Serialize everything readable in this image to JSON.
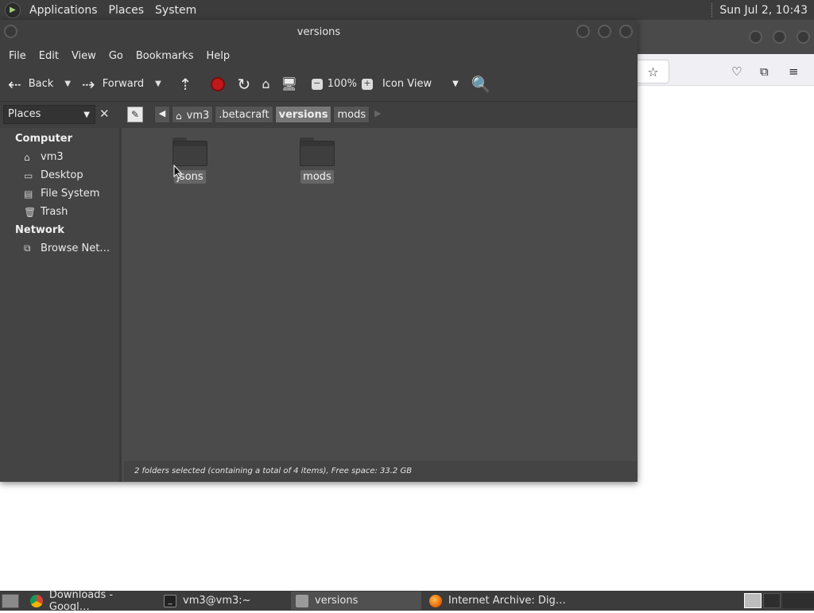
{
  "top_panel": {
    "menus": [
      "Applications",
      "Places",
      "System"
    ],
    "clock": "Sun Jul  2, 10:43"
  },
  "window": {
    "title": "versions",
    "menubar": [
      "File",
      "Edit",
      "View",
      "Go",
      "Bookmarks",
      "Help"
    ],
    "toolbar": {
      "back": "Back",
      "forward": "Forward",
      "zoom": "100%",
      "view_mode": "Icon View"
    },
    "location": {
      "sidebar_selector": "Places",
      "crumbs": [
        "vm3",
        ".betacraft",
        "versions",
        "mods"
      ],
      "active_crumb": "versions"
    },
    "sidebar": {
      "sections": [
        {
          "heading": "Computer",
          "items": [
            {
              "label": "vm3",
              "icon": "home-icon"
            },
            {
              "label": "Desktop",
              "icon": "desktop-icon"
            },
            {
              "label": "File System",
              "icon": "drive-icon"
            },
            {
              "label": "Trash",
              "icon": "trash-icon"
            }
          ]
        },
        {
          "heading": "Network",
          "items": [
            {
              "label": "Browse Net…",
              "icon": "network-icon"
            }
          ]
        }
      ]
    },
    "folders": [
      {
        "label": "jsons",
        "selected": true
      },
      {
        "label": "mods",
        "selected": true
      }
    ],
    "status": "2 folders selected (containing a total of 4 items), Free space: 33.2 GB"
  },
  "taskbar": {
    "tasks": [
      {
        "label": "Downloads - Googl…",
        "icon": "chrome-icon",
        "active": false
      },
      {
        "label": "vm3@vm3:~",
        "icon": "terminal-icon",
        "active": false
      },
      {
        "label": "versions",
        "icon": "folder-icon",
        "active": true
      },
      {
        "label": "Internet Archive: Dig…",
        "icon": "firefox-icon",
        "active": false
      }
    ]
  },
  "colors": {
    "panel": "#3c3c3c",
    "window_bg": "#4b4b4b",
    "stop_red": "#c0181b"
  }
}
